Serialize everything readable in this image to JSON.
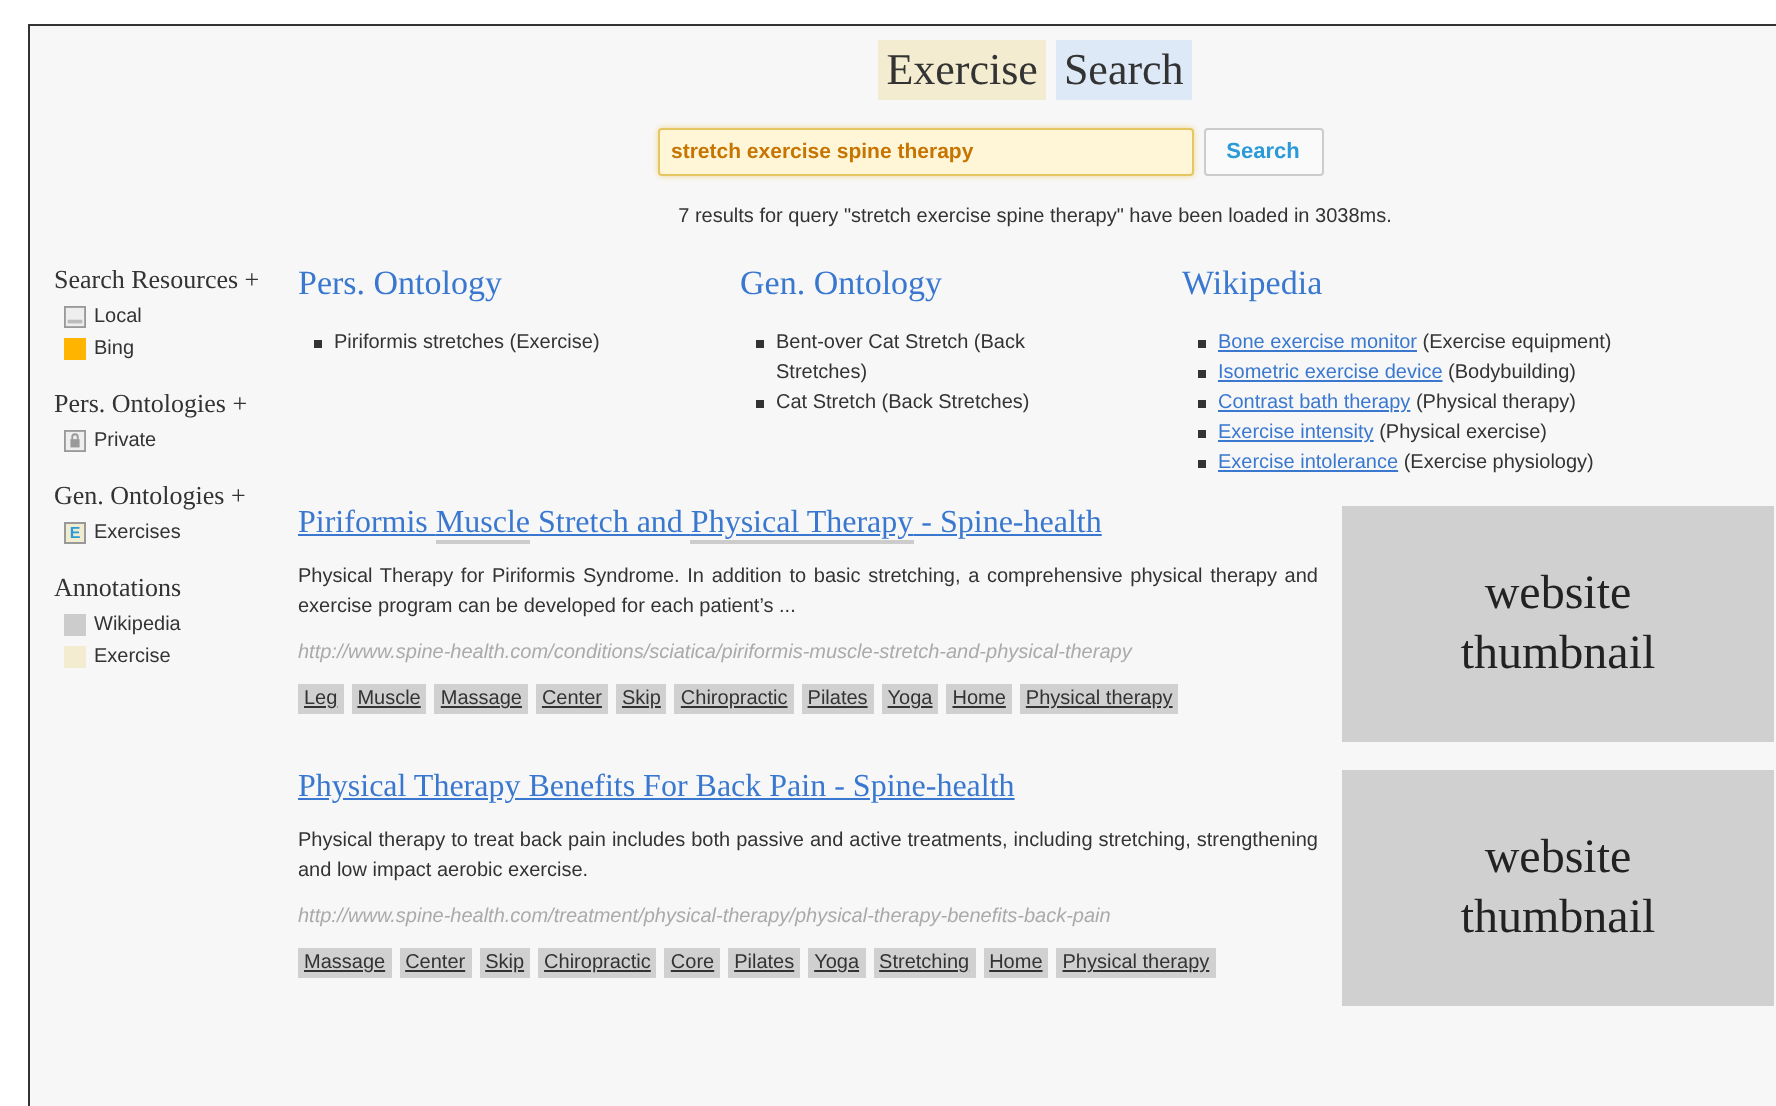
{
  "title": [
    "Exercise",
    "Search"
  ],
  "search": {
    "value": "stretch exercise spine therapy",
    "button": "Search"
  },
  "status": "7 results for query \"stretch exercise spine therapy\" have been loaded in 3038ms.",
  "sidebar": [
    {
      "heading": "Search Resources +",
      "items": [
        {
          "label": "Local",
          "kind": "drive"
        },
        {
          "label": "Bing",
          "kind": "swatch",
          "color": "#ffb400"
        }
      ]
    },
    {
      "heading": "Pers. Ontologies +",
      "items": [
        {
          "label": "Private",
          "kind": "lock"
        }
      ]
    },
    {
      "heading": "Gen. Ontologies +",
      "items": [
        {
          "label": "Exercises",
          "kind": "letter",
          "letter": "E"
        }
      ]
    },
    {
      "heading": "Annotations",
      "items": [
        {
          "label": "Wikipedia",
          "kind": "swatch",
          "color": "#cccccc"
        },
        {
          "label": "Exercise",
          "kind": "swatch",
          "color": "#f3ecd0"
        }
      ]
    }
  ],
  "ontologies": [
    {
      "heading": "Pers. Ontology",
      "items": [
        {
          "text": "Piriformis stretches (Exercise)"
        }
      ]
    },
    {
      "heading": "Gen. Ontology",
      "items": [
        {
          "text": "Bent-over Cat Stretch (Back Stretches)"
        },
        {
          "text": "Cat Stretch (Back Stretches)"
        }
      ]
    },
    {
      "heading": "Wikipedia",
      "items": [
        {
          "link": "Bone exercise monitor",
          "text": "(Exercise equipment)"
        },
        {
          "link": "Isometric exercise device",
          "text": "(Bodybuilding)"
        },
        {
          "link": "Contrast bath therapy",
          "text": "(Physical therapy)"
        },
        {
          "link": "Exercise intensity",
          "text": "(Physical exercise)"
        },
        {
          "link": "Exercise intolerance",
          "text": "(Exercise physiology)"
        }
      ]
    }
  ],
  "results": [
    {
      "title": [
        {
          "text": "Piriformis ",
          "annotated": false
        },
        {
          "text": "Muscle",
          "annotated": true
        },
        {
          "text": " Stretch and ",
          "annotated": false
        },
        {
          "text": "Physical Therapy",
          "annotated": true
        },
        {
          "text": " - Spine-health",
          "annotated": false
        }
      ],
      "snippet": "Physical Therapy for Piriformis Syndrome. In addition to basic stretching, a comprehensive physical therapy and exercise program can be developed for each patient’s ...",
      "url": "http://www.spine-health.com/conditions/sciatica/piriformis-muscle-stretch-and-physical-therapy",
      "tags": [
        "Leg",
        "Muscle",
        "Massage",
        "Center",
        "Skip",
        "Chiropractic",
        "Pilates",
        "Yoga",
        "Home",
        "Physical therapy"
      ],
      "thumbnail": "website thumbnail"
    },
    {
      "title": [
        {
          "text": "Physical Therapy Benefits For Back Pain - Spine-health",
          "annotated": false
        }
      ],
      "snippet": "Physical therapy to treat back pain includes both passive and active treatments, including stretching, strengthening and low impact aerobic exercise.",
      "url": "http://www.spine-health.com/treatment/physical-therapy/physical-therapy-benefits-back-pain",
      "tags": [
        "Massage",
        "Center",
        "Skip",
        "Chiropractic",
        "Core",
        "Pilates",
        "Yoga",
        "Stretching",
        "Home",
        "Physical therapy"
      ],
      "thumbnail": "website thumbnail"
    }
  ]
}
